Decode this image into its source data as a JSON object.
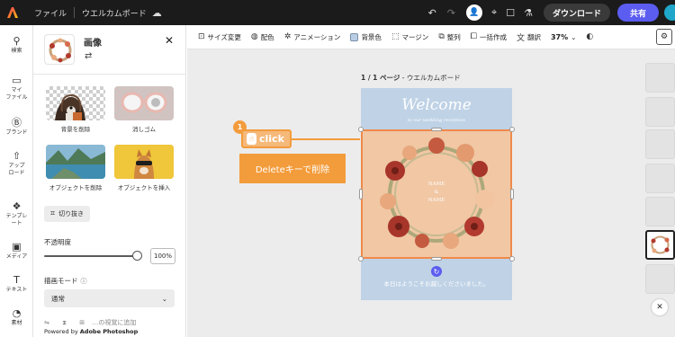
{
  "topbar": {
    "menu_file": "ファイル",
    "doc_title": "ウエルカムボード",
    "download_label": "ダウンロード",
    "share_label": "共有"
  },
  "rail": {
    "items": [
      {
        "label": "検索"
      },
      {
        "label": "マイ\nファイル"
      },
      {
        "label": "ブランド"
      },
      {
        "label": "アップ\nロード"
      },
      {
        "label": "テンプレ\nート"
      },
      {
        "label": "メディア"
      },
      {
        "label": "テキスト"
      },
      {
        "label": "素材"
      }
    ]
  },
  "panel": {
    "title": "画像",
    "tools": [
      {
        "label": "背景を削除"
      },
      {
        "label": "消しゴム"
      },
      {
        "label": "オブジェクトを削除"
      },
      {
        "label": "オブジェクトを挿入"
      }
    ],
    "crop_label": "切り抜き",
    "opacity_label": "不透明度",
    "opacity_value": "100%",
    "opacity_fraction": 1.0,
    "blend_label": "描画モード",
    "blend_value": "通常",
    "footer_partial": "…の視覚に追加",
    "powered_prefix": "Powered by",
    "powered_brand": "Adobe Photoshop"
  },
  "toolbar": {
    "resize": "サイズ変更",
    "color": "配色",
    "animation": "アニメーション",
    "background": "背景色",
    "margin": "マージン",
    "arrange": "整列",
    "bulk": "一括作成",
    "translate": "翻訳",
    "zoom": "37%"
  },
  "canvas": {
    "page_prefix": "1 / 1 ページ",
    "page_name": " - ウエルカムボード",
    "welcome": "Welcome",
    "welcome_sub": "to our wedding reception",
    "name1": "NAME",
    "amp": "&",
    "name2": "NAME",
    "bottom_message": "本日はようこそお越しくださいました。"
  },
  "annotation": {
    "step": "1",
    "click_text": "click",
    "delete_text": "Deleteキーで削除"
  },
  "colors": {
    "accent": "#5b5cf0",
    "annotation": "#f39c3c",
    "card_bg": "#bfd2e6",
    "selection": "#f08a4b"
  }
}
